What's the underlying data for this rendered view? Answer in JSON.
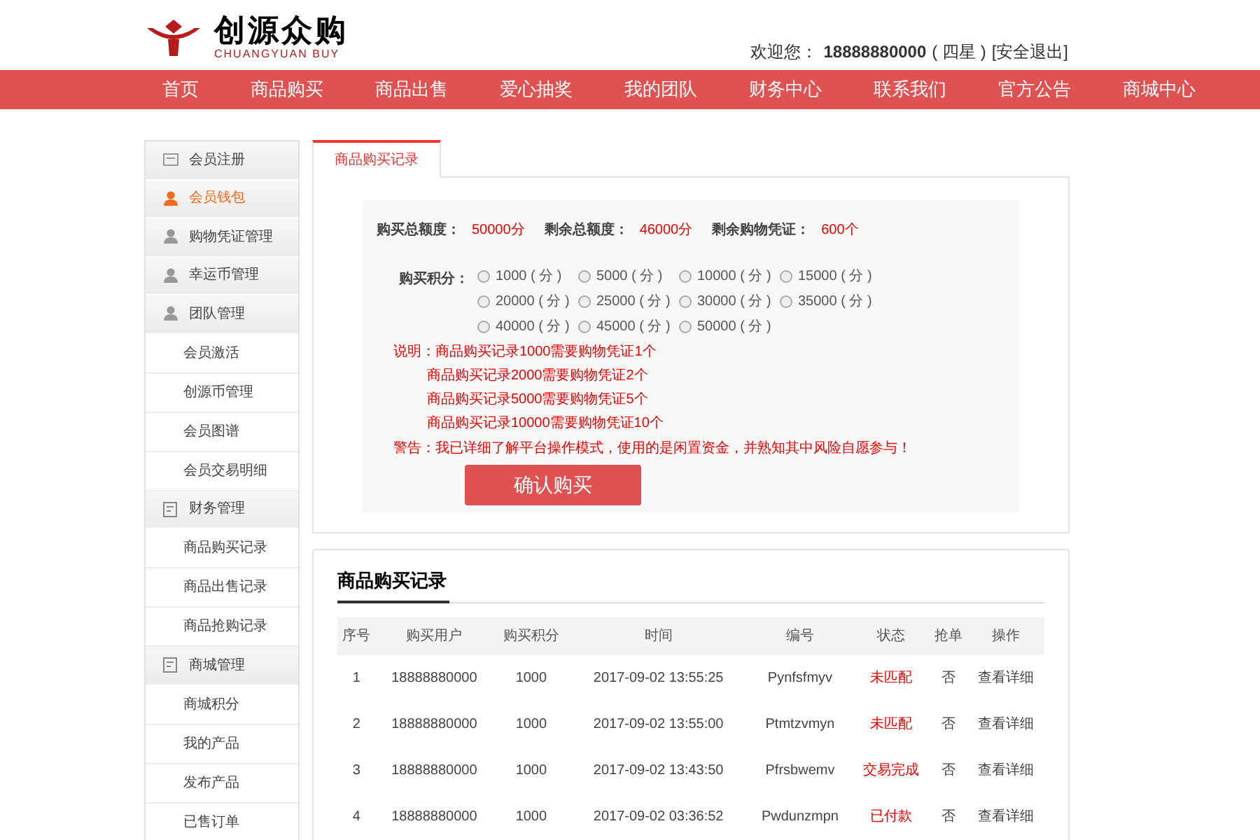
{
  "header": {
    "logo_title": "创源众购",
    "logo_subtitle": "CHUANGYUAN BUY",
    "welcome": "欢迎您：",
    "user": "18888880000",
    "level": "( 四星 )",
    "logout": "[安全退出]"
  },
  "nav": [
    "首页",
    "商品购买",
    "商品出售",
    "爱心抽奖",
    "我的团队",
    "财务中心",
    "联系我们",
    "官方公告",
    "商城中心"
  ],
  "sidebar": {
    "items": [
      {
        "kind": "card",
        "label": "会员注册",
        "selected": false
      },
      {
        "kind": "person",
        "label": "会员钱包",
        "selected": true
      },
      {
        "kind": "person",
        "label": "购物凭证管理",
        "selected": false
      },
      {
        "kind": "person",
        "label": "幸运币管理",
        "selected": false
      },
      {
        "kind": "person",
        "label": "团队管理",
        "selected": false
      },
      {
        "kind": "link",
        "label": "会员激活",
        "selected": false
      },
      {
        "kind": "link",
        "label": "创源币管理",
        "selected": false
      },
      {
        "kind": "link",
        "label": "会员图谱",
        "selected": false
      },
      {
        "kind": "link",
        "label": "会员交易明细",
        "selected": false
      },
      {
        "kind": "ledger",
        "label": "财务管理",
        "selected": false
      },
      {
        "kind": "link",
        "label": "商品购买记录",
        "selected": false
      },
      {
        "kind": "link",
        "label": "商品出售记录",
        "selected": false
      },
      {
        "kind": "link",
        "label": "商品抢购记录",
        "selected": false
      },
      {
        "kind": "ledger",
        "label": "商城管理",
        "selected": false
      },
      {
        "kind": "link",
        "label": "商城积分",
        "selected": false
      },
      {
        "kind": "link",
        "label": "我的产品",
        "selected": false
      },
      {
        "kind": "link",
        "label": "发布产品",
        "selected": false
      },
      {
        "kind": "link",
        "label": "已售订单",
        "selected": false
      }
    ]
  },
  "tabs": [
    {
      "label": "商品购买记录",
      "selected": true
    }
  ],
  "summary": [
    {
      "label": "购买总额度：",
      "value": "50000分"
    },
    {
      "label": "剩余总额度：",
      "value": "46000分"
    },
    {
      "label": "剩余购物凭证：",
      "value": "600个"
    }
  ],
  "points": {
    "label": "购买积分：",
    "options": [
      {
        "label": "1000 ( 分 )",
        "selected": false
      },
      {
        "label": "5000 ( 分 )",
        "selected": false
      },
      {
        "label": "10000 ( 分 )",
        "selected": false
      },
      {
        "label": "15000 ( 分 )",
        "selected": false
      },
      {
        "label": "20000 ( 分 )",
        "selected": false
      },
      {
        "label": "25000 ( 分 )",
        "selected": false
      },
      {
        "label": "30000 ( 分 )",
        "selected": false
      },
      {
        "label": "35000 ( 分 )",
        "selected": false
      },
      {
        "label": "40000 ( 分 )",
        "selected": false
      },
      {
        "label": "45000 ( 分 )",
        "selected": false
      },
      {
        "label": "50000 ( 分 )",
        "selected": false
      }
    ]
  },
  "notes": [
    "说明：商品购买记录1000需要购物凭证1个",
    "商品购买记录2000需要购物凭证2个",
    "商品购买记录5000需要购物凭证5个",
    "商品购买记录10000需要购物凭证10个"
  ],
  "warning": "警告：我已详细了解平台操作模式，使用的是闲置资金，并熟知其中风险自愿参与！",
  "confirm_button": "确认购买",
  "records": {
    "title": "商品购买记录",
    "columns": [
      "序号",
      "购买用户",
      "购买积分",
      "时间",
      "编号",
      "状态",
      "抢单",
      "操作"
    ],
    "rows": [
      [
        "1",
        "18888880000",
        "1000",
        "2017-09-02 13:55:25",
        "Pynfsfmyv",
        "未匹配",
        "否",
        "查看详细"
      ],
      [
        "2",
        "18888880000",
        "1000",
        "2017-09-02 13:55:00",
        "Ptmtzvmyn",
        "未匹配",
        "否",
        "查看详细"
      ],
      [
        "3",
        "18888880000",
        "1000",
        "2017-09-02 13:43:50",
        "Pfrsbwemv",
        "交易完成",
        "否",
        "查看详细"
      ],
      [
        "4",
        "18888880000",
        "1000",
        "2017-09-02 03:36:52",
        "Pwdunzmpn",
        "已付款",
        "否",
        "查看详细"
      ]
    ]
  }
}
